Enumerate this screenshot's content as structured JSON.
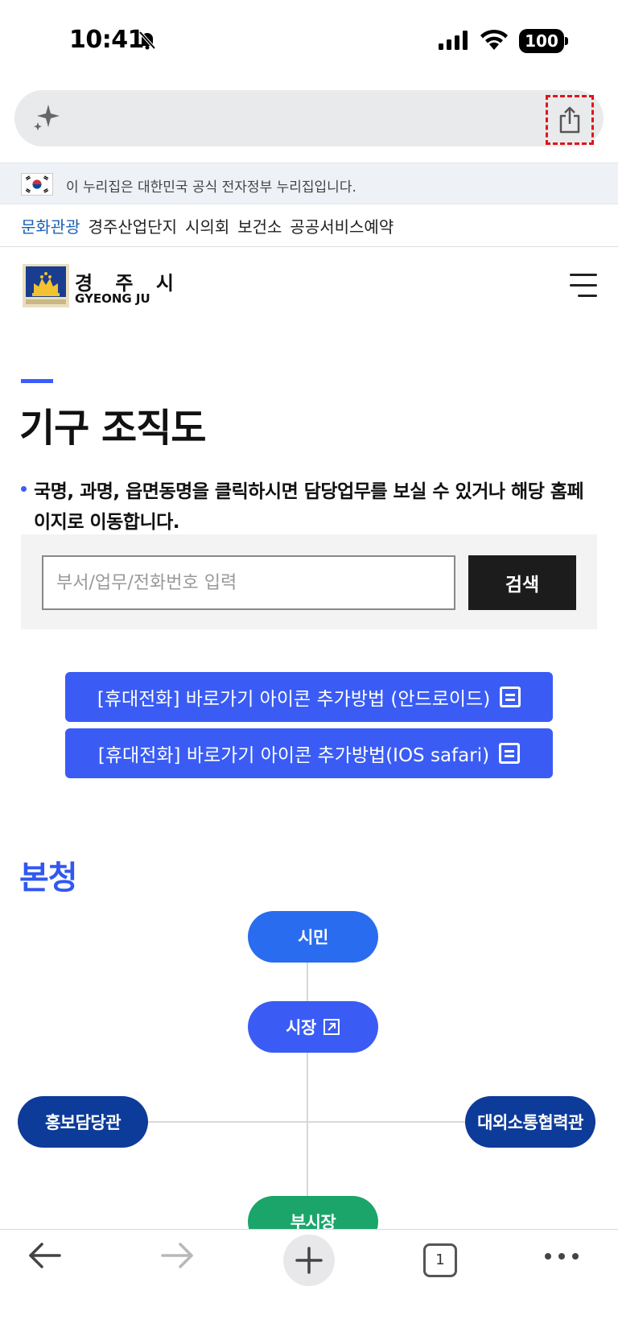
{
  "status_bar": {
    "time": "10:41",
    "battery": "100"
  },
  "address_bar": {
    "icon": "sparkle-icon",
    "share_icon": "share-icon",
    "highlight_color": "#e0151b"
  },
  "gov_banner": {
    "text": "이 누리집은 대한민국 공식 전자정부 누리집입니다."
  },
  "quick_links": [
    {
      "label": "문화관광",
      "active": true
    },
    {
      "label": "경주산업단지",
      "active": false
    },
    {
      "label": "시의회",
      "active": false
    },
    {
      "label": "보건소",
      "active": false
    },
    {
      "label": "공공서비스예약",
      "active": false
    }
  ],
  "header": {
    "logo_kr": "경 주 시",
    "logo_en": "GYEONG JU"
  },
  "page": {
    "title": "기구 조직도",
    "notice": "국명, 과명, 읍면동명을 클릭하시면 담당업무를 보실 수 있거나 해당 홈페이지로 이동합니다."
  },
  "search": {
    "placeholder": "부서/업무/전화번호 입력",
    "button": "검색"
  },
  "guides": [
    {
      "label": "[휴대전화] 바로가기 아이콘 추가방법 (안드로이드)"
    },
    {
      "label": "[휴대전화] 바로가기 아이콘 추가방법(IOS safari)"
    }
  ],
  "section": {
    "title": "본청"
  },
  "org_chart": {
    "citizen": "시민",
    "mayor": "시장",
    "left": "홍보담당관",
    "right": "대외소통협력관",
    "vice": "부시장"
  },
  "toolbar": {
    "tab_count": "1"
  },
  "colors": {
    "accent": "#3a5cf5",
    "dark_node": "#0d3b99",
    "green_node": "#1ba56a"
  }
}
